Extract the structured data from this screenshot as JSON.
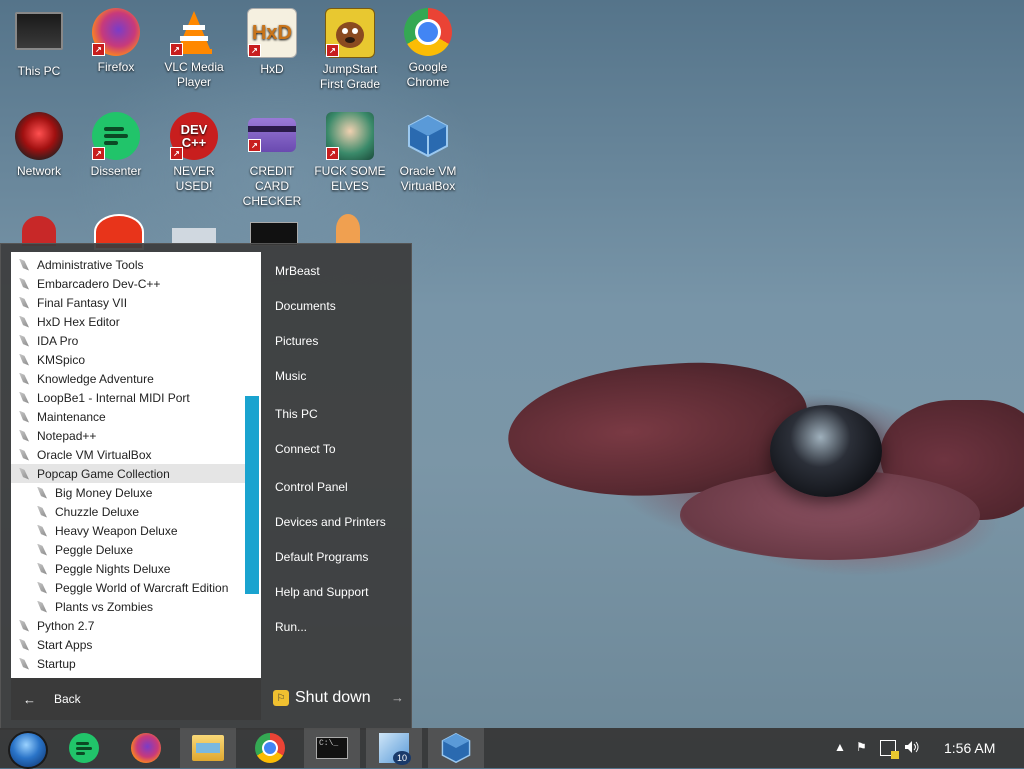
{
  "desktop_icons": [
    {
      "label": "This PC",
      "icon": "monitor-icon"
    },
    {
      "label": "Firefox",
      "icon": "firefox-icon"
    },
    {
      "label": "VLC Media Player",
      "icon": "vlc-cone-icon"
    },
    {
      "label": "HxD",
      "icon": "hxd-icon"
    },
    {
      "label": "JumpStart First Grade",
      "icon": "jumpstart-dog-icon"
    },
    {
      "label": "Google Chrome",
      "icon": "chrome-icon"
    },
    {
      "label": "Network",
      "icon": "network-orb-icon"
    },
    {
      "label": "Dissenter",
      "icon": "dissenter-icon"
    },
    {
      "label": "NEVER USED!",
      "icon": "devcpp-icon"
    },
    {
      "label": "CREDIT CARD CHECKER",
      "icon": "credit-card-icon"
    },
    {
      "label": "FUCK SOME ELVES",
      "icon": "elf-icon"
    },
    {
      "label": "Oracle VM VirtualBox",
      "icon": "virtualbox-icon"
    }
  ],
  "start_menu": {
    "programs": [
      {
        "label": "Administrative Tools",
        "kind": "folder"
      },
      {
        "label": "Embarcadero Dev-C++",
        "kind": "folder"
      },
      {
        "label": "Final Fantasy VII",
        "kind": "folder"
      },
      {
        "label": "HxD Hex Editor",
        "kind": "folder"
      },
      {
        "label": "IDA Pro",
        "kind": "folder"
      },
      {
        "label": "KMSpico",
        "kind": "folder"
      },
      {
        "label": "Knowledge Adventure",
        "kind": "folder"
      },
      {
        "label": "LoopBe1 - Internal MIDI Port",
        "kind": "folder"
      },
      {
        "label": "Maintenance",
        "kind": "folder"
      },
      {
        "label": "Notepad++",
        "kind": "folder"
      },
      {
        "label": "Oracle VM VirtualBox",
        "kind": "folder"
      },
      {
        "label": "Popcap Game Collection",
        "kind": "folder",
        "hover": true
      },
      {
        "label": "Big Money Deluxe",
        "kind": "sub"
      },
      {
        "label": "Chuzzle Deluxe",
        "kind": "sub"
      },
      {
        "label": "Heavy Weapon Deluxe",
        "kind": "sub"
      },
      {
        "label": "Peggle Deluxe",
        "kind": "sub"
      },
      {
        "label": "Peggle Nights Deluxe",
        "kind": "sub"
      },
      {
        "label": "Peggle World of Warcraft Edition",
        "kind": "sub"
      },
      {
        "label": "Plants vs Zombies",
        "kind": "sub"
      },
      {
        "label": "Python 2.7",
        "kind": "folder"
      },
      {
        "label": "Start Apps",
        "kind": "folder"
      },
      {
        "label": "Startup",
        "kind": "folder"
      }
    ],
    "back_label": "Back",
    "right_items": [
      {
        "label": "MrBeast"
      },
      {
        "label": "Documents"
      },
      {
        "label": "Pictures"
      },
      {
        "label": "Music"
      },
      {
        "label": "This PC"
      },
      {
        "label": "Connect To"
      },
      {
        "label": "Control Panel"
      },
      {
        "label": "Devices and Printers"
      },
      {
        "label": "Default Programs"
      },
      {
        "label": "Help and Support"
      },
      {
        "label": "Run..."
      }
    ],
    "shutdown_label": "Shut down"
  },
  "taskbar": {
    "pinned": [
      {
        "name": "dissenter",
        "icon": "dissenter-icon"
      },
      {
        "name": "firefox",
        "icon": "firefox-icon"
      },
      {
        "name": "file-explorer",
        "icon": "folder-icon"
      },
      {
        "name": "chrome",
        "icon": "chrome-icon"
      },
      {
        "name": "command-prompt",
        "icon": "cmd-icon"
      },
      {
        "name": "windows-10-app",
        "icon": "win10-icon"
      },
      {
        "name": "virtualbox",
        "icon": "virtualbox-icon"
      }
    ],
    "clock": "1:56 AM"
  },
  "colors": {
    "accent": "#1aa3cf",
    "taskbar": "#373737",
    "menu": "#3c3c3c"
  }
}
